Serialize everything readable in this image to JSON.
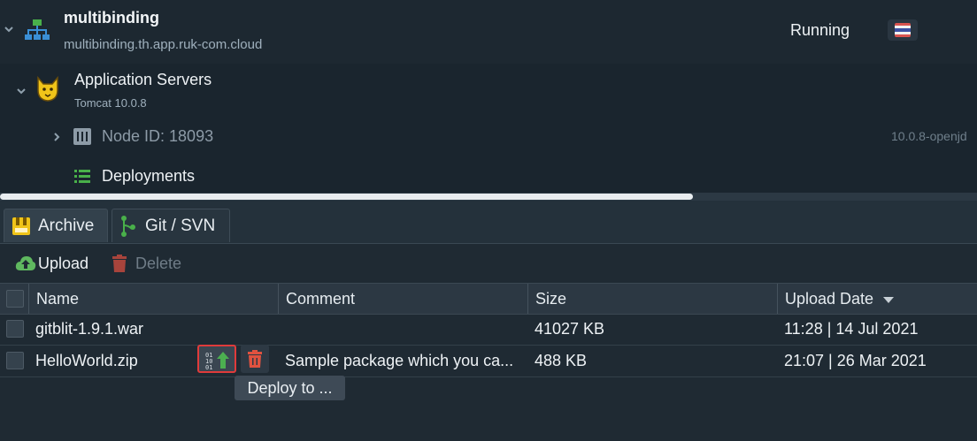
{
  "environment": {
    "name": "multibinding",
    "domain": "multibinding.th.app.ruk-com.cloud",
    "status": "Running"
  },
  "node_group": {
    "title": "Application Servers",
    "subtitle": "Tomcat 10.0.8"
  },
  "node": {
    "id_label": "Node ID: 18093",
    "version": "10.0.8-openjd"
  },
  "deployments_label": "Deployments",
  "tabs": [
    {
      "label": "Archive",
      "active": true
    },
    {
      "label": "Git / SVN",
      "active": false
    }
  ],
  "toolbar": {
    "upload_label": "Upload",
    "delete_label": "Delete"
  },
  "table": {
    "columns": [
      "Name",
      "Comment",
      "Size",
      "Upload Date"
    ],
    "sort_column": "Upload Date",
    "rows": [
      {
        "name": "gitblit-1.9.1.war",
        "comment": "",
        "size": "41027 KB",
        "date": "11:28 | 14 Jul 2021"
      },
      {
        "name": "HelloWorld.zip",
        "comment": "Sample package which you ca...",
        "size": "488 KB",
        "date": "21:07 | 26 Mar 2021"
      }
    ]
  },
  "tooltip": "Deploy to ...",
  "colors": {
    "background": "#1f2a33",
    "highlight": "#e03b3b",
    "upload_green": "#5fb85f",
    "delete_red": "#c9473c",
    "deploy_green": "#4caf50"
  },
  "icons": [
    "environment-icon",
    "tomcat-icon",
    "node-icon",
    "deployments-icon",
    "archive-icon",
    "git-icon",
    "upload-icon",
    "trash-icon",
    "deploy-icon",
    "sort-desc-icon",
    "flag-icon",
    "chevron-down-icon",
    "chevron-right-icon"
  ]
}
